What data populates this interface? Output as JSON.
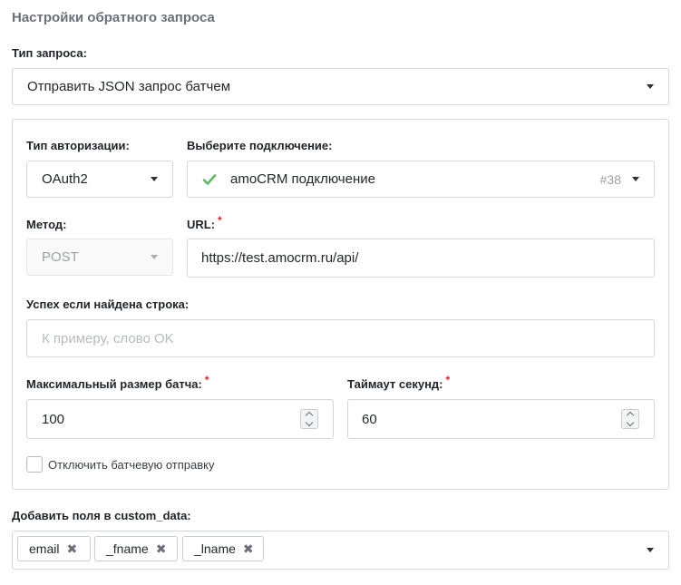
{
  "section_title": "Настройки обратного запроса",
  "request_type": {
    "label": "Тип запроса:",
    "value": "Отправить JSON запрос батчем"
  },
  "auth": {
    "label": "Тип авторизации:",
    "value": "OAuth2"
  },
  "connection": {
    "label": "Выберите подключение:",
    "value": "amoCRM подключение",
    "id": "#38",
    "status_icon": "check-icon",
    "status_color": "#5cb85c"
  },
  "method": {
    "label": "Метод:",
    "value": "POST"
  },
  "url": {
    "label": "URL:",
    "required_mark": "*",
    "value": "https://test.amocrm.ru/api/"
  },
  "success_string": {
    "label": "Успех если найдена строка:",
    "placeholder": "К примеру, слово OK"
  },
  "batch_size": {
    "label": "Максимальный размер батча:",
    "required_mark": "*",
    "value": "100"
  },
  "timeout": {
    "label": "Таймаут секунд:",
    "required_mark": "*",
    "value": "60"
  },
  "disable_batch": {
    "label": "Отключить батчевую отправку",
    "checked": false
  },
  "custom_data": {
    "label": "Добавить поля в custom_data:",
    "tags": [
      {
        "label": "email",
        "remove_icon": "close-icon"
      },
      {
        "label": "_fname",
        "remove_icon": "close-icon"
      },
      {
        "label": "_lname",
        "remove_icon": "close-icon"
      }
    ]
  },
  "colors": {
    "required": "#e0242e",
    "border": "#d3d6da",
    "success": "#5cb85c"
  }
}
